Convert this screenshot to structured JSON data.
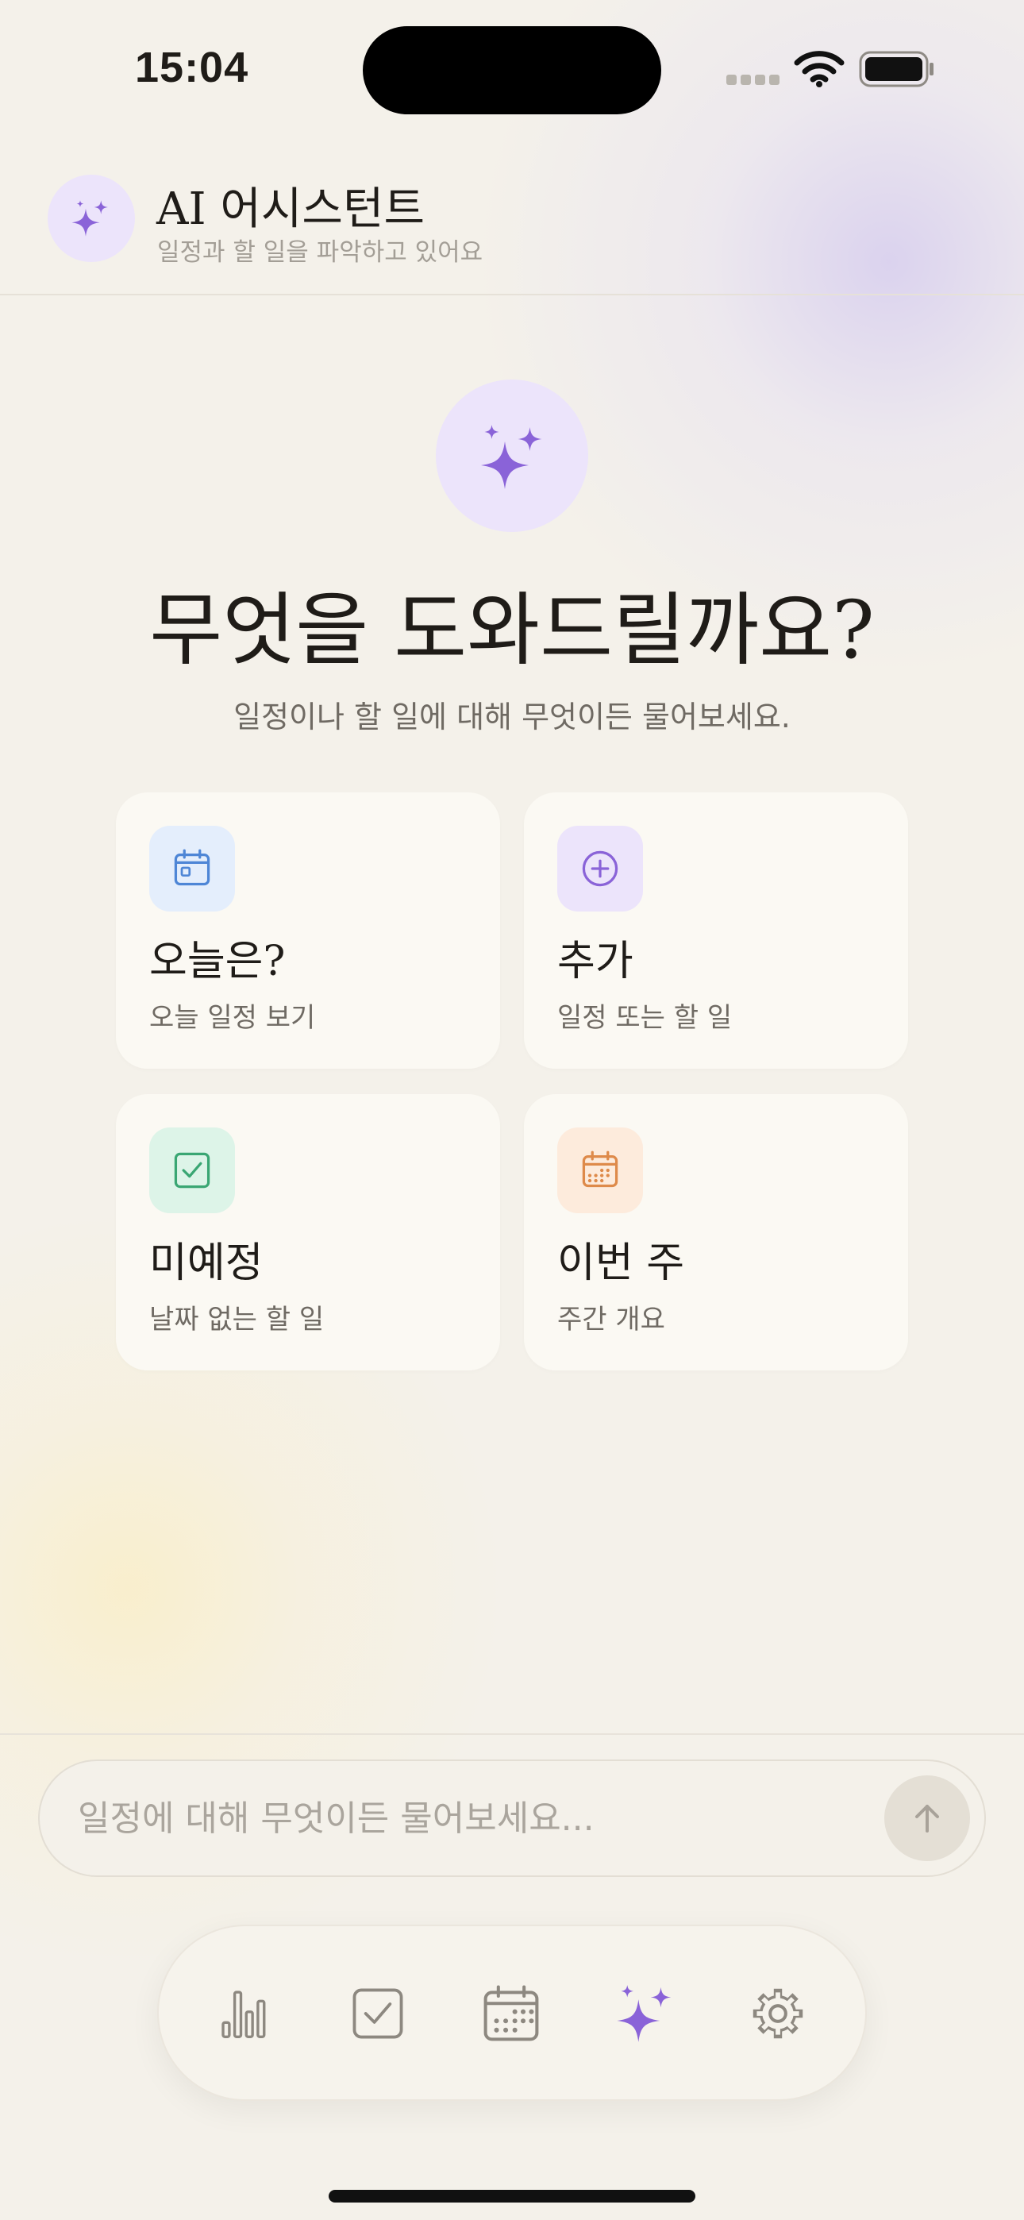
{
  "status_bar": {
    "time": "15:04"
  },
  "header": {
    "title": "AI 어시스턴트",
    "subtitle": "일정과 할 일을 파악하고 있어요",
    "icon": "sparkles-icon"
  },
  "hero": {
    "title": "무엇을 도와드릴까요?",
    "subtitle": "일정이나 할 일에 대해 무엇이든 물어보세요."
  },
  "cards": [
    {
      "title": "오늘은?",
      "desc": "오늘 일정 보기",
      "icon": "calendar-today-icon",
      "color": "#4e86d6",
      "bg": "#e4eefc"
    },
    {
      "title": "추가",
      "desc": "일정 또는 할 일",
      "icon": "plus-circle-icon",
      "color": "#8a63d8",
      "bg": "#ece4fb"
    },
    {
      "title": "미예정",
      "desc": "날짜 없는 할 일",
      "icon": "checkbox-icon",
      "color": "#3aa673",
      "bg": "#ddf4e8"
    },
    {
      "title": "이번 주",
      "desc": "주간 개요",
      "icon": "calendar-week-icon",
      "color": "#de8a4a",
      "bg": "#fdebdc"
    }
  ],
  "input": {
    "placeholder": "일정에 대해 무엇이든 물어보세요..."
  },
  "tab_bar": {
    "items": [
      {
        "icon": "bar-chart-icon",
        "active": false
      },
      {
        "icon": "checkbox-icon",
        "active": false
      },
      {
        "icon": "calendar-icon",
        "active": false
      },
      {
        "icon": "sparkles-icon",
        "active": true
      },
      {
        "icon": "gear-icon",
        "active": false
      }
    ]
  },
  "colors": {
    "accent": "#8a63d8",
    "accent_soft": "#ece4fb",
    "background": "#f4f1ea",
    "card": "#fbf9f3",
    "text_primary": "#1f1c18",
    "text_secondary": "#6f6a63",
    "text_muted": "#a39e96"
  }
}
